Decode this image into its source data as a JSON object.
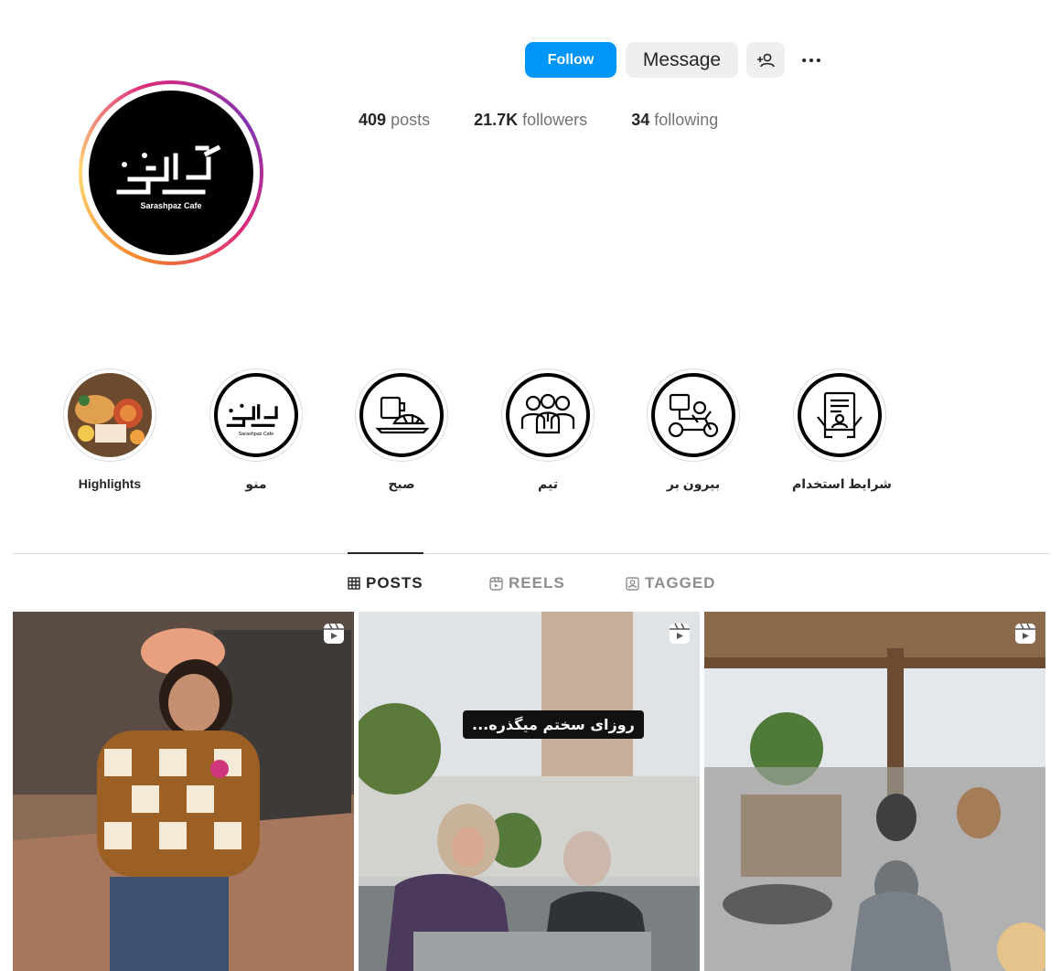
{
  "profile": {
    "logo_text": "Sarashpaz Cafe",
    "follow_label": "Follow",
    "message_label": "Message",
    "add_user_icon": "person-plus-icon",
    "more_icon": "ellipsis-icon"
  },
  "stats": {
    "posts_count": "409",
    "posts_label": "posts",
    "followers_count": "21.7K",
    "followers_label": "followers",
    "following_count": "34",
    "following_label": "following"
  },
  "highlights": [
    {
      "label": "Highlights",
      "icon": "food-photo"
    },
    {
      "label": "منو",
      "icon": "logo-icon"
    },
    {
      "label": "صبح",
      "icon": "breakfast-icon"
    },
    {
      "label": "تیم",
      "icon": "team-icon"
    },
    {
      "label": "بیرون بر",
      "icon": "delivery-scooter-icon"
    },
    {
      "label": "شرایط استخدام",
      "icon": "hiring-document-icon"
    }
  ],
  "tabs": [
    {
      "label": "POSTS",
      "icon": "grid-icon",
      "active": true
    },
    {
      "label": "REELS",
      "icon": "reels-icon",
      "active": false
    },
    {
      "label": "TAGGED",
      "icon": "tagged-icon",
      "active": false
    }
  ],
  "posts": [
    {
      "type": "reel",
      "caption": ""
    },
    {
      "type": "reel",
      "caption": "روزای سختم میگذره..."
    },
    {
      "type": "reel",
      "caption": ""
    }
  ],
  "colors": {
    "accent": "#0095f6",
    "text": "#262626",
    "muted": "#737373"
  }
}
